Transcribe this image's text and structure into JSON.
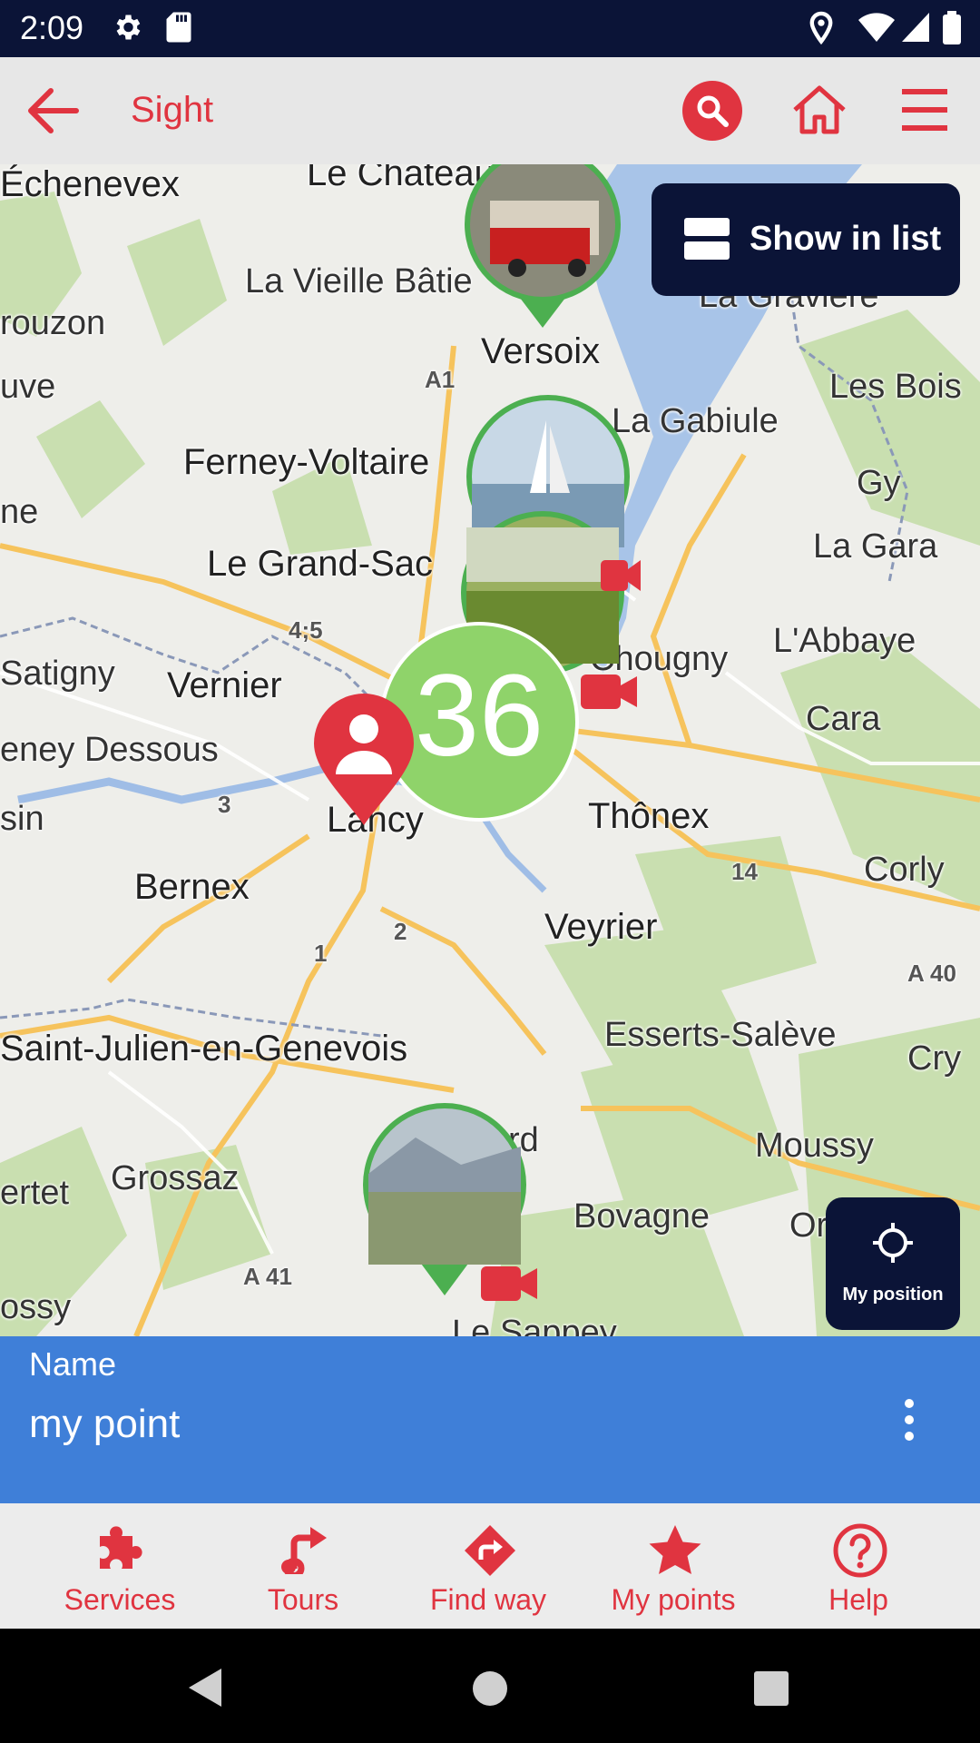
{
  "status_bar": {
    "time": "2:09",
    "icons": [
      "settings-icon",
      "sd-card-icon",
      "location-icon",
      "wifi-icon",
      "signal-icon",
      "battery-icon"
    ]
  },
  "app_bar": {
    "title": "Sight",
    "icons": [
      "back-arrow-icon",
      "search-icon",
      "home-icon",
      "menu-icon"
    ]
  },
  "map": {
    "show_list_label": "Show in list",
    "my_position_label": "My position",
    "cluster_count": "36",
    "places": [
      "Échenevex",
      "Le Chateau",
      "La Vieille Bâtie",
      "Versoix",
      "La Gravière",
      "rouzon",
      "A1",
      "uve",
      "Les Bois",
      "La Gabiule",
      "Ferney-Voltaire",
      "Gy",
      "ne",
      "Le Grand-Sac",
      "La Gara",
      "4;5",
      "L'Abbaye",
      "Chougny",
      "Satigny",
      "Vernier",
      "Cara",
      "eney Dessous",
      "3",
      "Lancy",
      "Thônex",
      "sin",
      "Bernex",
      "14",
      "Corly",
      "Veyrier",
      "2",
      "1",
      "A 40",
      "Esserts-Salève",
      "Saint-Julien-en-Genevois",
      "Cry",
      "Moussy",
      "rd",
      "ertet",
      "Grossaz",
      "Bovagne",
      "Or",
      "A 41",
      "ossy",
      "Le Sappey"
    ]
  },
  "info_panel": {
    "caption": "Name",
    "value": "my point",
    "menu_icon": "more-vert-icon"
  },
  "bottom_nav": [
    {
      "label": "Services",
      "icon": "puzzle-icon"
    },
    {
      "label": "Tours",
      "icon": "turn-arrow-icon"
    },
    {
      "label": "Find way",
      "icon": "directions-icon"
    },
    {
      "label": "My points",
      "icon": "star-icon"
    },
    {
      "label": "Help",
      "icon": "help-icon"
    }
  ],
  "colors": {
    "accent": "#e03440",
    "navy": "#0b1437",
    "panel_blue": "#3f7fd8",
    "marker_green": "#4caf50"
  }
}
